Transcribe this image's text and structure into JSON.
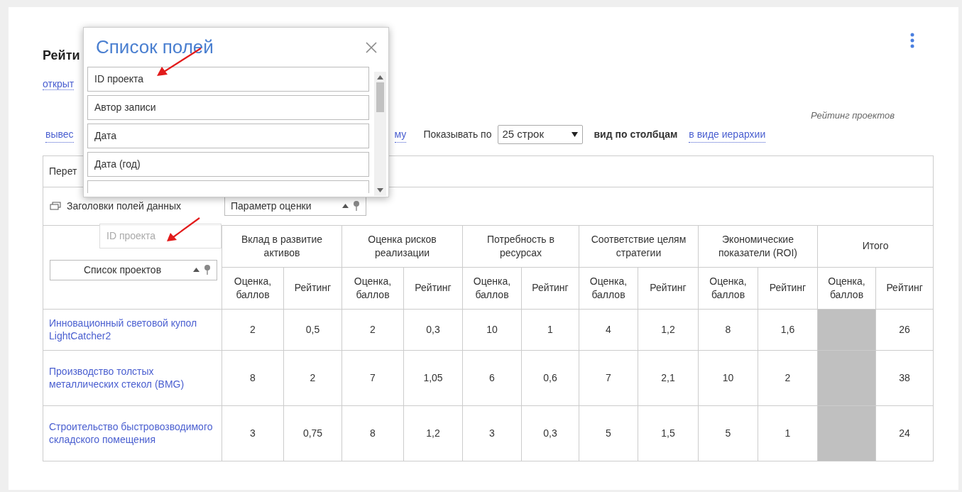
{
  "title": "Рейти",
  "open_link": "открыт",
  "caption": "Рейтинг проектов",
  "toolbar": {
    "left_link": "вывес",
    "right_link": "му",
    "page_size_label": "Показывать по",
    "page_size": "25 строк",
    "view_modes": [
      {
        "label": "вид по столбцам",
        "selected": true
      },
      {
        "label": "в виде иерархии",
        "selected": false
      }
    ]
  },
  "filter_area": "Перет",
  "data_headers_label": "Заголовки полей данных",
  "column_field": "Параметр оценки",
  "row_field": "Список проектов",
  "drag_ghost": "ID проекта",
  "groups": [
    {
      "label": "Вклад в развитие активов",
      "subcolumns": [
        "Оценка, баллов",
        "Рейтинг"
      ]
    },
    {
      "label": "Оценка рисков реализации",
      "subcolumns": [
        "Оценка, баллов",
        "Рейтинг"
      ]
    },
    {
      "label": "Потребность в ресурсах",
      "subcolumns": [
        "Оценка, баллов",
        "Рейтинг"
      ]
    },
    {
      "label": "Соответствие целям стратегии",
      "subcolumns": [
        "Оценка, баллов",
        "Рейтинг"
      ]
    },
    {
      "label": "Экономические показатели (ROI)",
      "subcolumns": [
        "Оценка, баллов",
        "Рейтинг"
      ]
    },
    {
      "label": "Итого",
      "subcolumns": [
        "Оценка, баллов",
        "Рейтинг"
      ]
    }
  ],
  "rows": [
    {
      "name": "Инновационный световой купол LightCatcher2",
      "cells": [
        "2",
        "0,5",
        "2",
        "0,3",
        "10",
        "1",
        "4",
        "1,2",
        "8",
        "1,6",
        null,
        "26"
      ]
    },
    {
      "name": "Производство толстых металлических стекол (BMG)",
      "cells": [
        "8",
        "2",
        "7",
        "1,05",
        "6",
        "0,6",
        "7",
        "2,1",
        "10",
        "2",
        null,
        "38"
      ]
    },
    {
      "name": "Строительство быстровозводимого складского помещения",
      "cells": [
        "3",
        "0,75",
        "8",
        "1,2",
        "3",
        "0,3",
        "5",
        "1,5",
        "5",
        "1",
        null,
        "24"
      ]
    }
  ],
  "popup": {
    "title": "Список полей",
    "fields": [
      "ID проекта",
      "Автор записи",
      "Дата",
      "Дата (год)"
    ]
  }
}
